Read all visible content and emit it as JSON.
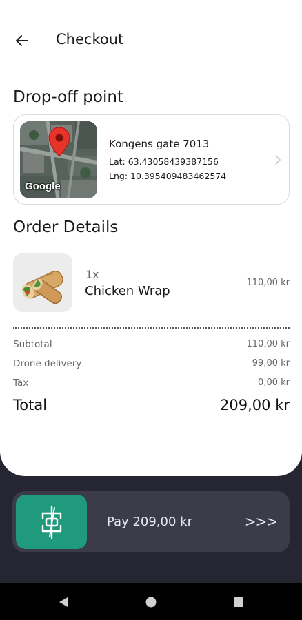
{
  "header": {
    "title": "Checkout",
    "back_icon": "arrow-left-icon"
  },
  "dropoff": {
    "section_title": "Drop-off point",
    "map_provider_label": "Google",
    "address": "Kongens gate 7013",
    "lat_text": "Lat: 63.43058439387156",
    "lng_text": "Lng: 10.395409483462574",
    "pin_icon": "map-pin-icon",
    "chevron_icon": "chevron-right-icon"
  },
  "order": {
    "section_title": "Order Details",
    "items": [
      {
        "quantity": "1x",
        "name": "Chicken Wrap",
        "price": "110,00 kr",
        "image_icon": "wrap-food-image"
      }
    ]
  },
  "summary": {
    "rows": [
      {
        "label": "Subtotal",
        "value": "110,00 kr"
      },
      {
        "label": "Drone delivery",
        "value": "99,00 kr"
      },
      {
        "label": "Tax",
        "value": "0,00 kr"
      }
    ],
    "total_label": "Total",
    "total_value": "209,00 kr"
  },
  "pay": {
    "label": "Pay 209,00 kr",
    "arrows": ">>>",
    "knob_icon": "drone-icon"
  },
  "navbar": {
    "back_icon": "triangle-back-icon",
    "home_icon": "circle-home-icon",
    "recents_icon": "square-recents-icon"
  },
  "colors": {
    "accent": "#1f9a7d",
    "background_dark": "#262633",
    "pay_bar": "#3b3b4a"
  }
}
